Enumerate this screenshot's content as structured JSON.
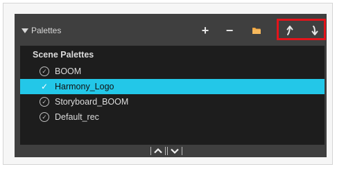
{
  "panel": {
    "title": "Palettes"
  },
  "toolbar": {
    "add_label": "+",
    "remove_label": "−",
    "import_icon": "folder-icon",
    "move_up_icon": "arrow-up-icon",
    "move_down_icon": "arrow-down-icon"
  },
  "list": {
    "header": "Scene Palettes",
    "items": [
      {
        "label": "BOOM",
        "selected": false
      },
      {
        "label": "Harmony_Logo",
        "selected": true
      },
      {
        "label": "Storyboard_BOOM",
        "selected": false
      },
      {
        "label": "Default_rec",
        "selected": false
      }
    ]
  },
  "colors": {
    "panel_bg": "#3f3f3f",
    "list_bg": "#1d1d1d",
    "selection": "#23c7e8",
    "highlight_box": "#e3141b",
    "folder_icon": "#f0a640"
  }
}
